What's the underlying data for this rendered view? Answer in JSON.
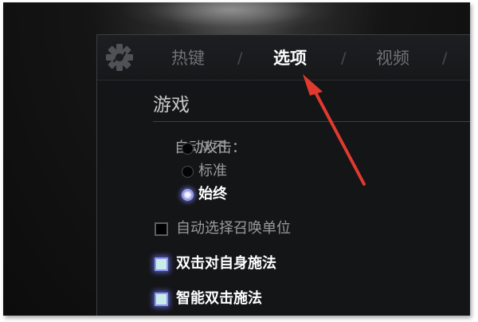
{
  "tabs": [
    {
      "label": "热键",
      "active": false
    },
    {
      "label": "选项",
      "active": true
    },
    {
      "label": "视频",
      "active": false
    }
  ],
  "tab_separator": "/",
  "section": {
    "title": "游戏"
  },
  "auto_attack": {
    "label": "自动攻击：",
    "options": [
      {
        "label": "从不",
        "selected": false
      },
      {
        "label": "标准",
        "selected": false
      },
      {
        "label": "始终",
        "selected": true
      }
    ]
  },
  "checkboxes": [
    {
      "label": "自动选择召唤单位",
      "checked": false
    },
    {
      "label": "双击对自身施法",
      "checked": true
    },
    {
      "label": "智能双击施法",
      "checked": true
    }
  ],
  "colors": {
    "accent_glow": "#6e74e6",
    "annotation_arrow": "#e03a2f"
  },
  "icons": {
    "settings": "gear-icon",
    "annotation": "red-arrow-annotation"
  }
}
